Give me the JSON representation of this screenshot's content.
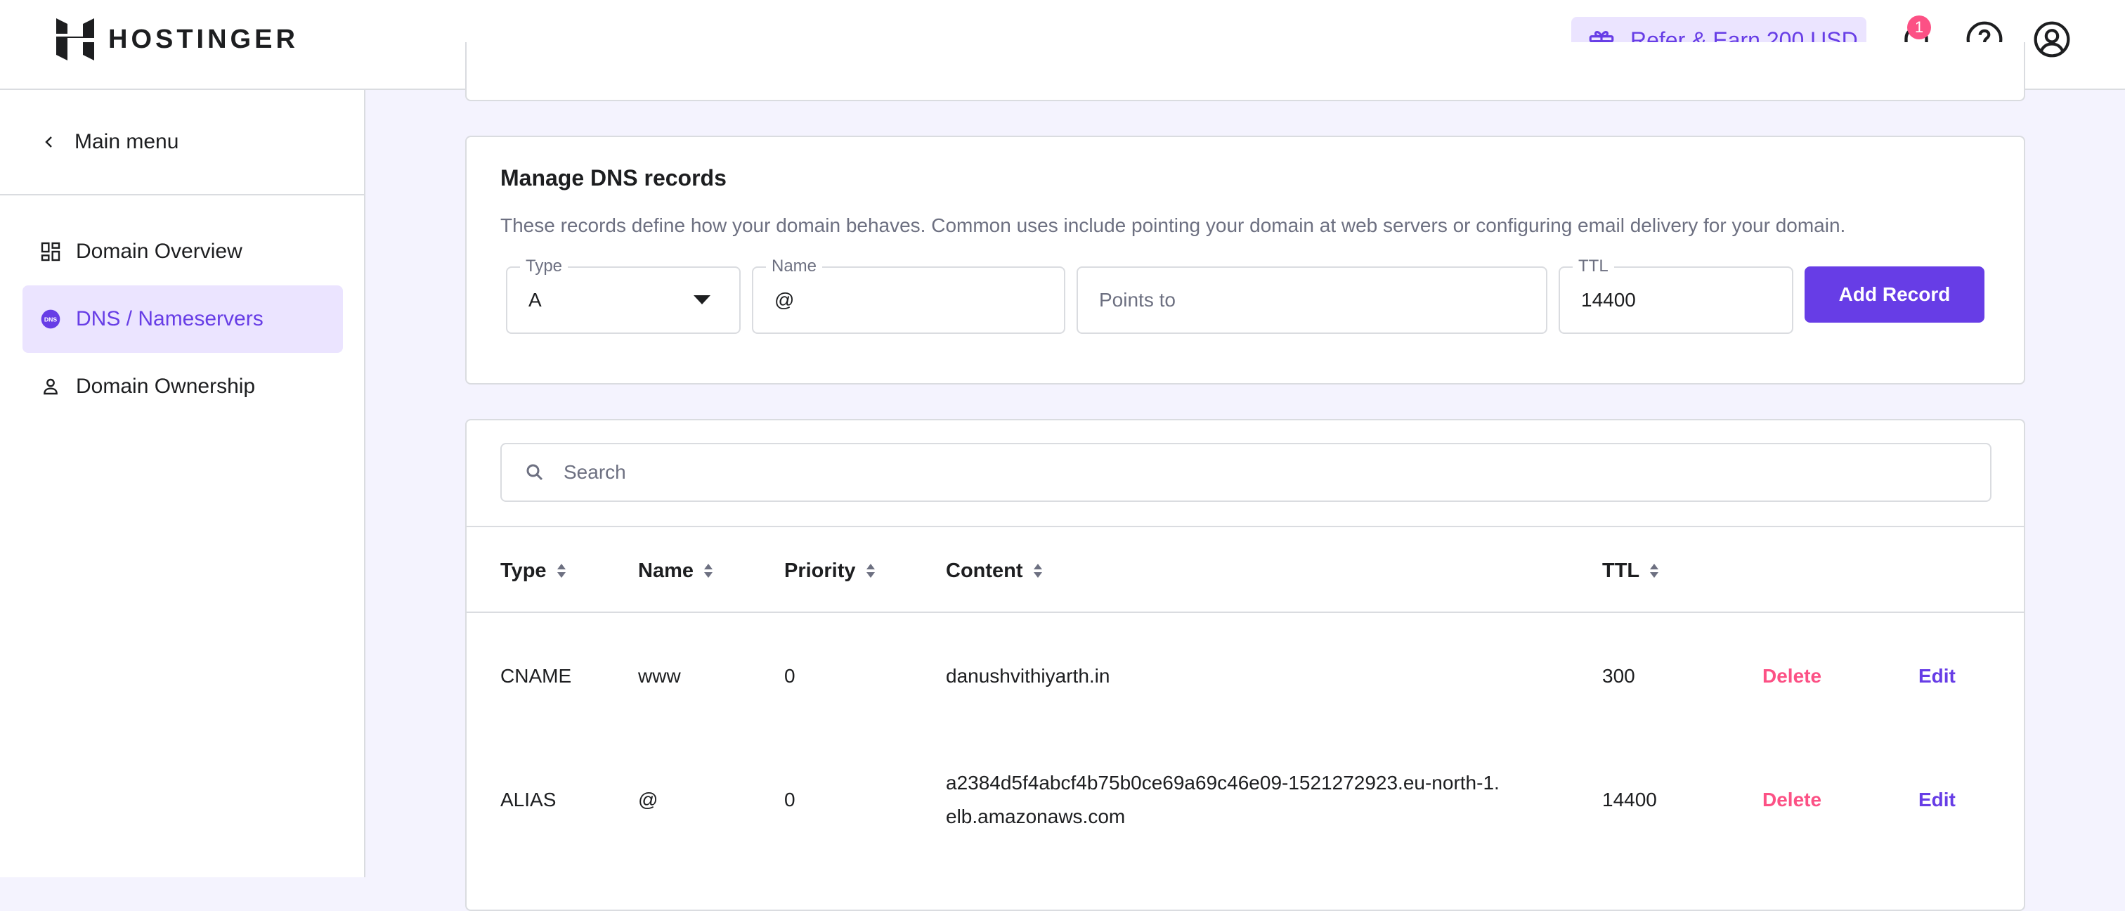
{
  "header": {
    "brand": "HOSTINGER",
    "refer_label": "Refer & Earn 200 USD",
    "notification_count": "1"
  },
  "sidebar": {
    "main_menu": "Main menu",
    "items": [
      {
        "label": "Domain Overview",
        "icon": "grid-icon",
        "active": false
      },
      {
        "label": "DNS / Nameservers",
        "icon": "dns-icon",
        "active": true
      },
      {
        "label": "Domain Ownership",
        "icon": "person-icon",
        "active": false
      }
    ]
  },
  "manage": {
    "title": "Manage DNS records",
    "description": "These records define how your domain behaves. Common uses include pointing your domain at web servers or configuring email delivery for your domain.",
    "type_label": "Type",
    "type_value": "A",
    "name_label": "Name",
    "name_value": "@",
    "points_placeholder": "Points to",
    "ttl_label": "TTL",
    "ttl_value": "14400",
    "add_button": "Add Record"
  },
  "table": {
    "search_placeholder": "Search",
    "columns": [
      "Type",
      "Name",
      "Priority",
      "Content",
      "TTL"
    ],
    "rows": [
      {
        "type": "CNAME",
        "name": "www",
        "priority": "0",
        "content_line1": "danushvithiyarth.in",
        "content_line2": "",
        "ttl": "300",
        "delete": "Delete",
        "edit": "Edit"
      },
      {
        "type": "ALIAS",
        "name": "@",
        "priority": "0",
        "content_line1": "a2384d5f4abcf4b75b0ce69a69c46e09-1521272923.eu-north-1.",
        "content_line2": "elb.amazonaws.com",
        "ttl": "14400",
        "delete": "Delete",
        "edit": "Edit"
      }
    ]
  },
  "colors": {
    "accent": "#673de6",
    "accent_light": "#ebe4ff",
    "danger": "#fc5185",
    "page_bg": "#f4f3fe"
  }
}
